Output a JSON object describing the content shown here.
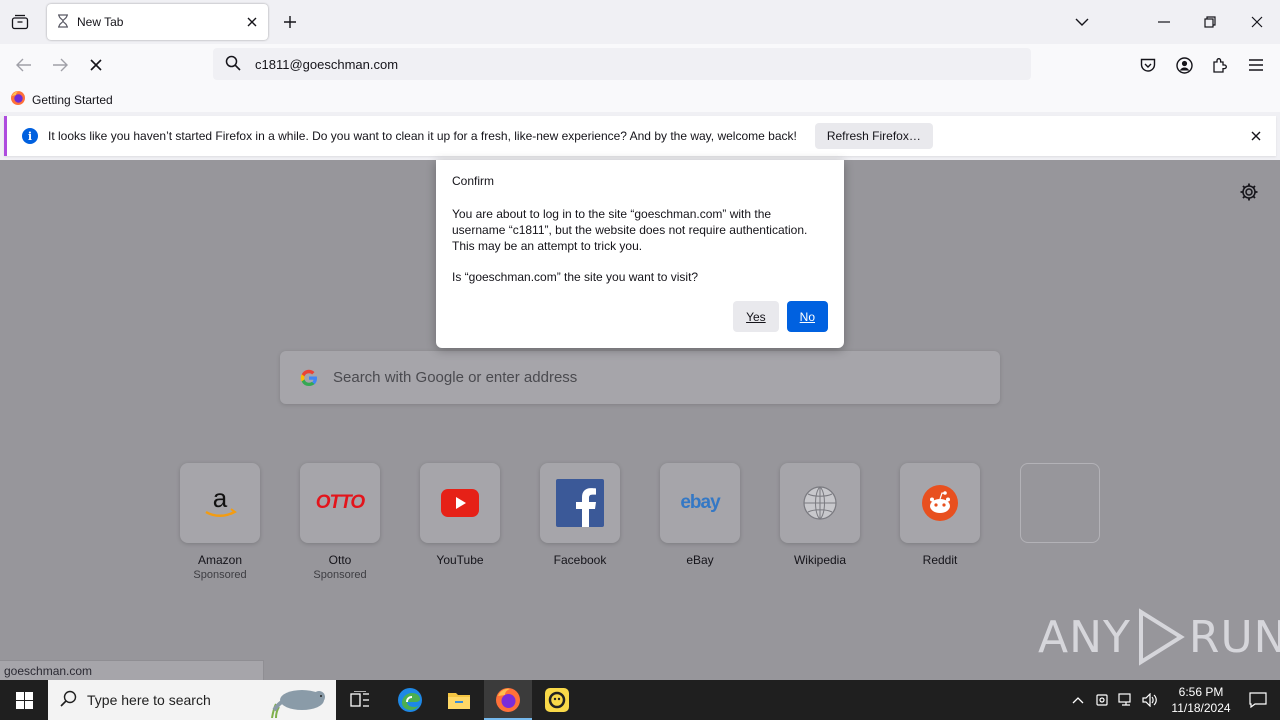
{
  "tab": {
    "title": "New Tab"
  },
  "urlbar": {
    "value": "c1811@goeschman.com"
  },
  "bookmarks": {
    "getting_started": "Getting Started"
  },
  "notification": {
    "message": "It looks like you haven’t started Firefox in a while. Do you want to clean it up for a fresh, like-new experience? And by the way, welcome back!",
    "button": "Refresh Firefox…"
  },
  "dialog": {
    "title": "Confirm",
    "body": "You are about to log in to the site “goeschman.com” with the username “c1811”, but the website does not require authentication. This may be an attempt to trick you.",
    "question": "Is “goeschman.com” the site you want to visit?",
    "yes": "Yes",
    "no": "No"
  },
  "newtab": {
    "search_placeholder": "Search with Google or enter address",
    "tiles": [
      {
        "label": "Amazon",
        "sponsored": "Sponsored"
      },
      {
        "label": "Otto",
        "sponsored": "Sponsored"
      },
      {
        "label": "YouTube"
      },
      {
        "label": "Facebook"
      },
      {
        "label": "eBay"
      },
      {
        "label": "Wikipedia"
      },
      {
        "label": "Reddit"
      }
    ],
    "otto_logo_text": "OTTO",
    "ebay_logo_text": "ebay"
  },
  "status_link": "goeschman.com",
  "watermark": {
    "left": "ANY",
    "right": "RUN"
  },
  "taskbar": {
    "search_placeholder": "Type here to search",
    "time": "6:56 PM",
    "date": "11/18/2024"
  },
  "colors": {
    "accent": "#0061e0",
    "notice_border": "#ae4cde",
    "overlay": "#97969b"
  }
}
